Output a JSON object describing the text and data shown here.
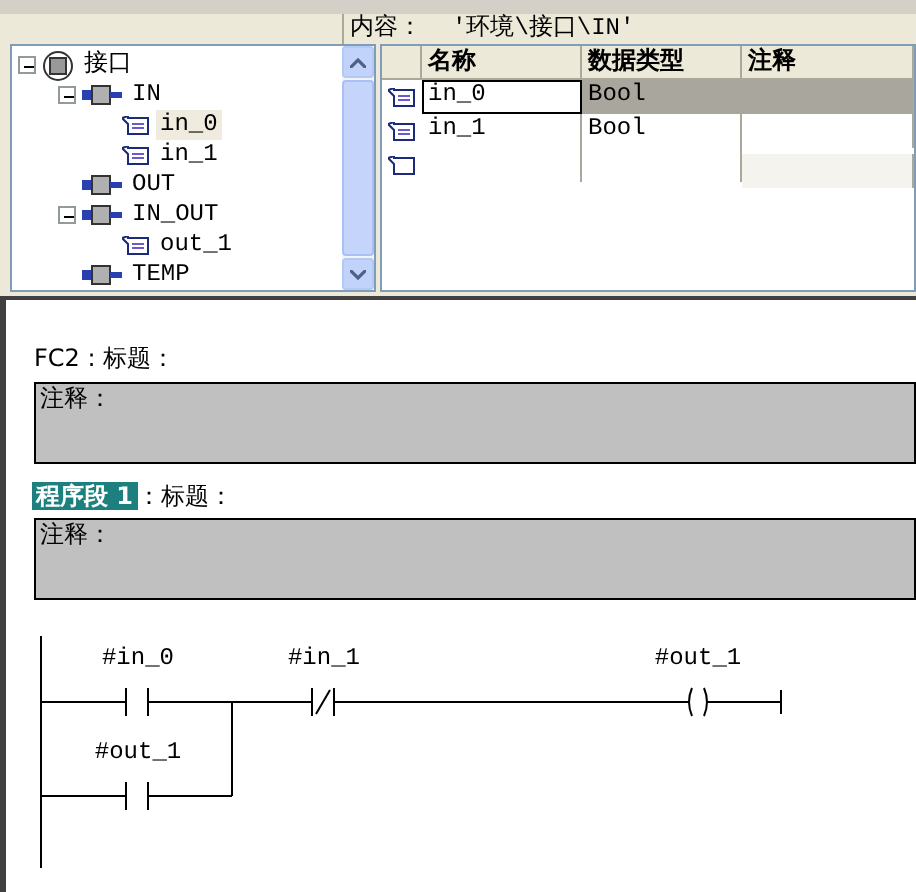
{
  "header": {
    "label": "内容：",
    "path": "'环境\\接口\\IN'"
  },
  "tree": [
    {
      "label": "接口",
      "kind": "root",
      "expanded": true,
      "children": [
        {
          "label": "IN",
          "kind": "section",
          "expanded": true,
          "children": [
            {
              "label": "in_0",
              "kind": "param",
              "selected": true
            },
            {
              "label": "in_1",
              "kind": "param",
              "selected": false
            }
          ]
        },
        {
          "label": "OUT",
          "kind": "section"
        },
        {
          "label": "IN_OUT",
          "kind": "section",
          "expanded": true,
          "children": [
            {
              "label": "out_1",
              "kind": "param",
              "selected": false
            }
          ]
        },
        {
          "label": "TEMP",
          "kind": "section"
        }
      ]
    }
  ],
  "table": {
    "columns": [
      "名称",
      "数据类型",
      "注释"
    ],
    "rows": [
      {
        "name": "in_0",
        "data_type": "Bool",
        "selected": true
      },
      {
        "name": "in_1",
        "data_type": "Bool",
        "selected": false
      }
    ]
  },
  "block": {
    "title": "FC2 : 标题：",
    "comment": "注释："
  },
  "networks": [
    {
      "label": "程序段 1",
      "selected": true,
      "title": "：标题：",
      "comment": "注释："
    }
  ],
  "ladder": {
    "series": [
      {
        "kind": "no",
        "operand": "#in_0"
      },
      {
        "kind": "nc",
        "operand": "#in_1"
      },
      {
        "kind": "coil",
        "operand": "#out_1"
      }
    ],
    "branch": {
      "kind": "no",
      "operand": "#out_1"
    }
  }
}
